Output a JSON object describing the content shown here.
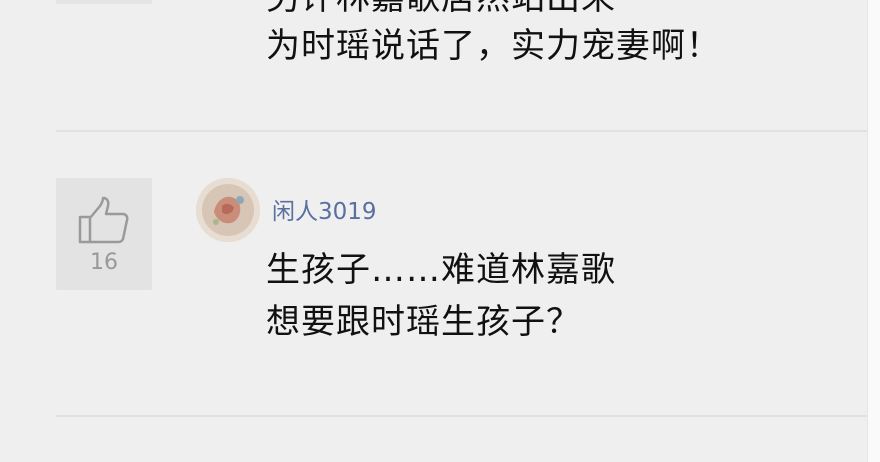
{
  "previous_comment": {
    "line1": "另评林嘉歌居然站出来",
    "line2": "为时瑶说话了，实力宠妻啊！"
  },
  "comment": {
    "likes": "16",
    "username": "闲人3019",
    "line1": "生孩子……难道林嘉歌",
    "line2": "想要跟时瑶生孩子？"
  },
  "colors": {
    "username": "#596fa0",
    "like_count": "#999999",
    "background": "#efefef"
  },
  "icons": {
    "like": "thumbs-up-icon"
  }
}
